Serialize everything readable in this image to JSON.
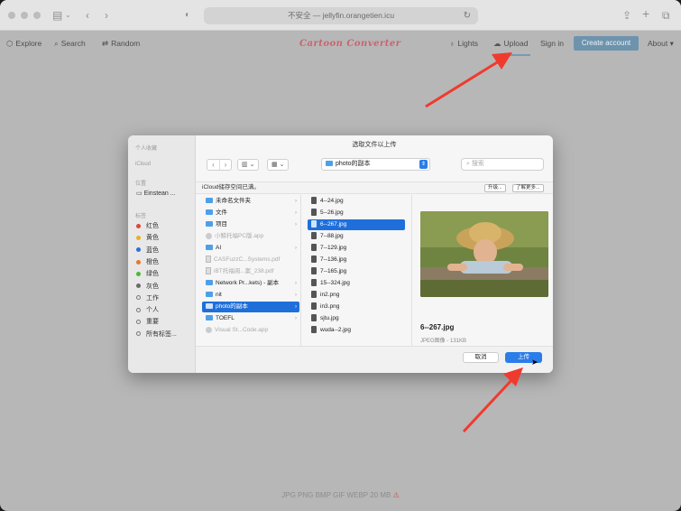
{
  "browser": {
    "url": "不安全 — jellyfin.orangetien.icu"
  },
  "site": {
    "brand": "Cartoon Converter",
    "nav_left": [
      {
        "label": "Explore",
        "icon": "cube-icon"
      },
      {
        "label": "Search",
        "icon": "search-icon"
      },
      {
        "label": "Random",
        "icon": "shuffle-icon"
      }
    ],
    "lights": "Lights",
    "upload": "Upload",
    "signin": "Sign in",
    "create_account": "Create account",
    "about": "About",
    "footer_formats": "JPG PNG BMP GIF WEBP",
    "footer_size": "20 MB"
  },
  "dialog": {
    "title": "选取文件以上传",
    "folder": "photo的副本",
    "search_placeholder": "搜索",
    "icloud_notice": "iCloud储存空间已满。",
    "upgrade": "升级...",
    "learn_more": "了解更多...",
    "cancel": "取消",
    "upload": "上传",
    "sidebar": {
      "favorites_header": "个人收藏",
      "icloud_header": "iCloud",
      "locations_header": "位置",
      "location_item": "Einstean ...",
      "tags_header": "标签",
      "tags": [
        {
          "label": "红色",
          "color": "#e0443c"
        },
        {
          "label": "黄色",
          "color": "#e2b329"
        },
        {
          "label": "蓝色",
          "color": "#2f6fdc"
        },
        {
          "label": "橙色",
          "color": "#e8762f"
        },
        {
          "label": "绿色",
          "color": "#4cb83b"
        },
        {
          "label": "灰色",
          "color": "#6b6b6b"
        },
        {
          "label": "工作",
          "color": ""
        },
        {
          "label": "个人",
          "color": ""
        },
        {
          "label": "重要",
          "color": ""
        },
        {
          "label": "所有标签...",
          "color": ""
        }
      ]
    },
    "col1": [
      {
        "label": "未命名文件夹",
        "type": "folder",
        "dim": false,
        "sel": false
      },
      {
        "label": "文件",
        "type": "folder",
        "dim": false,
        "sel": false
      },
      {
        "label": "项目",
        "type": "folder",
        "dim": false,
        "sel": false
      },
      {
        "label": "小鲸托福PC版.app",
        "type": "app",
        "dim": true,
        "sel": false
      },
      {
        "label": "AI",
        "type": "folder",
        "dim": false,
        "sel": false
      },
      {
        "label": "CASFuzzC...Systems.pdf",
        "type": "pdf",
        "dim": true,
        "sel": false
      },
      {
        "label": "iBT托福阅...案_238.pdf",
        "type": "pdf",
        "dim": true,
        "sel": false
      },
      {
        "label": "Network Pr...kets) - 副本",
        "type": "folder",
        "dim": false,
        "sel": false
      },
      {
        "label": "nit",
        "type": "folder",
        "dim": false,
        "sel": false
      },
      {
        "label": "photo的副本",
        "type": "folder",
        "dim": false,
        "sel": true
      },
      {
        "label": "TOEFL",
        "type": "folder",
        "dim": false,
        "sel": false
      },
      {
        "label": "Visual St...Code.app",
        "type": "app",
        "dim": true,
        "sel": false
      }
    ],
    "col2": [
      {
        "label": "4--24.jpg",
        "sel": false
      },
      {
        "label": "5--26.jpg",
        "sel": false
      },
      {
        "label": "6--267.jpg",
        "sel": true
      },
      {
        "label": "7--88.jpg",
        "sel": false
      },
      {
        "label": "7--129.jpg",
        "sel": false
      },
      {
        "label": "7--136.jpg",
        "sel": false
      },
      {
        "label": "7--165.jpg",
        "sel": false
      },
      {
        "label": "15--324.jpg",
        "sel": false
      },
      {
        "label": "in2.png",
        "sel": false
      },
      {
        "label": "in3.png",
        "sel": false
      },
      {
        "label": "sjtu.jpg",
        "sel": false
      },
      {
        "label": "wuda--2.jpg",
        "sel": false
      }
    ],
    "preview": {
      "name": "6--267.jpg",
      "meta": "JPEG图像 - 131KB"
    }
  }
}
